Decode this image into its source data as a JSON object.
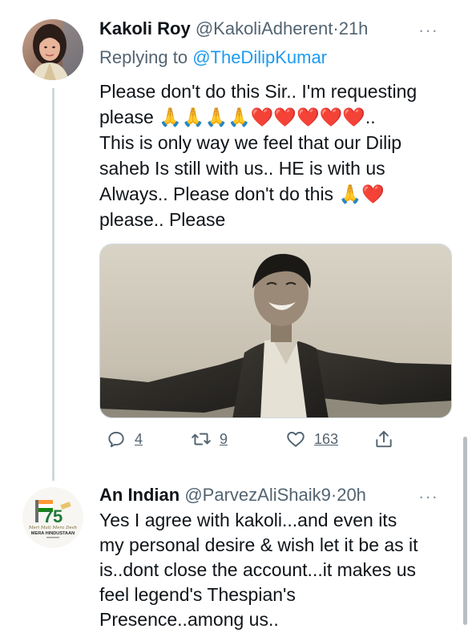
{
  "tweets": [
    {
      "display_name": "Kakoli Roy",
      "handle": "@KakoliAdherent",
      "separator": "·",
      "time": "21h",
      "more": "···",
      "replying_to_prefix": "Replying to ",
      "replying_to": "@TheDilipKumar",
      "text_lines": [
        "Please don't do this Sir.. I'm requesting",
        "please 🙏🙏🙏🙏❤️❤️❤️❤️❤️..",
        "This is only way we feel that our Dilip",
        "saheb Is still with us.. HE is with us",
        "Always.. Please don't do this 🙏❤️",
        "please.. Please"
      ],
      "actions": {
        "reply_count": "4",
        "retweet_count": "9",
        "like_count": "163"
      }
    },
    {
      "display_name": "An Indian",
      "handle": "@ParvezAliShaik9",
      "separator": "·",
      "time": "20h",
      "more": "···",
      "avatar_text": {
        "number": "75",
        "script": "Meri Mati Mera Desh",
        "caption": "MERA HINDUSTAAN"
      },
      "text_lines": [
        "Yes I agree with kakoli...and even its",
        "my personal desire & wish let it be as it",
        "is..dont close the account...it makes us",
        "feel legend's Thespian's",
        "Presence..among us.."
      ]
    }
  ],
  "colors": {
    "link": "#1d9bf0",
    "secondary_text": "#536471",
    "primary_text": "#0f1419",
    "divider": "#cfd9de"
  }
}
